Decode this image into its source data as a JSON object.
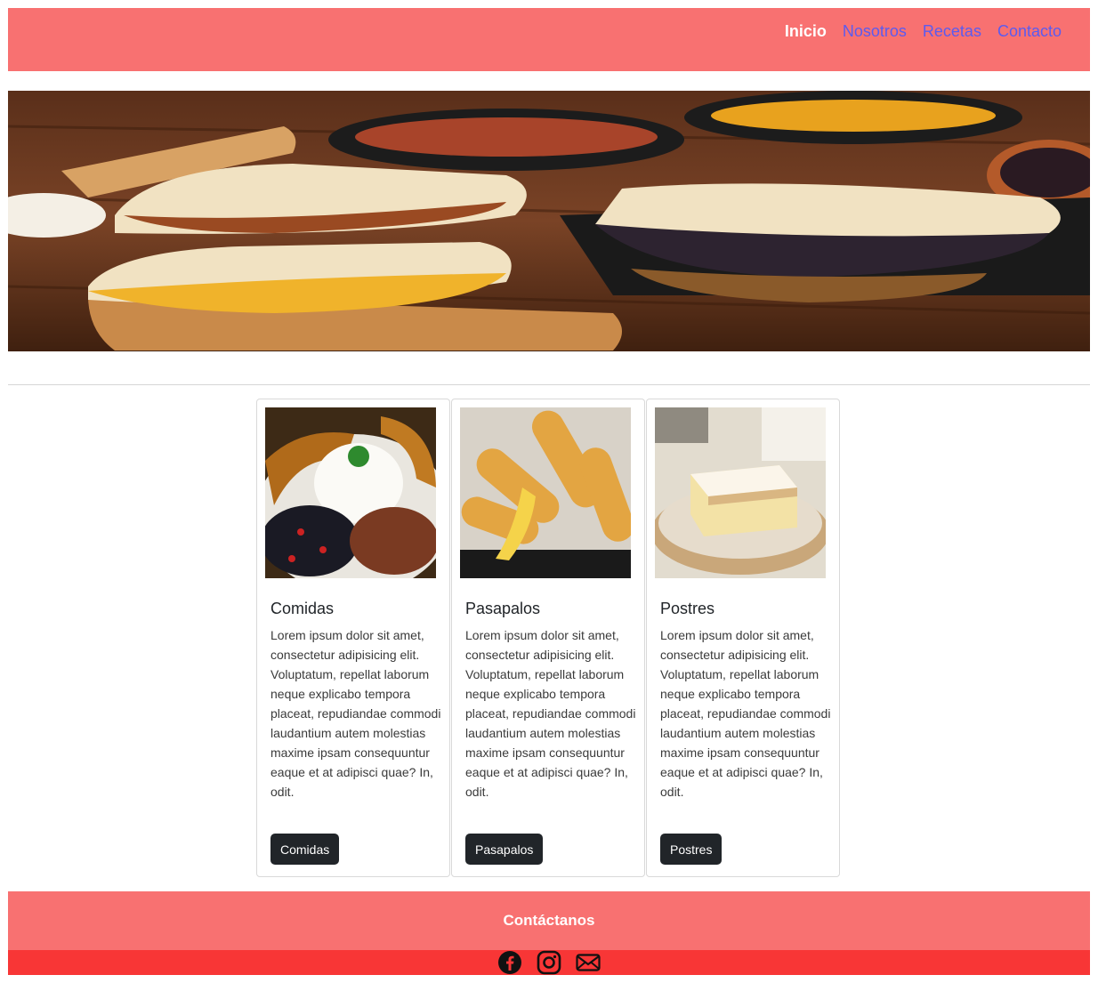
{
  "nav": {
    "links": [
      {
        "label": "Inicio",
        "active": true
      },
      {
        "label": "Nosotros"
      },
      {
        "label": "Recetas"
      },
      {
        "label": "Contacto"
      }
    ]
  },
  "hero": {
    "image": "venezuelan-arepas-photo"
  },
  "cards": [
    {
      "image": "comidas-photo",
      "title": "Comidas",
      "text": "Lorem ipsum dolor sit amet, consectetur adipisicing elit. Voluptatum, repellat laborum neque explicabo tempora placeat, repudiandae commodi laudantium autem molestias maxime ipsam consequuntur eaque et at adipisci quae? In, odit.",
      "button": "Comidas"
    },
    {
      "image": "pasapalos-photo",
      "title": "Pasapalos",
      "text": "Lorem ipsum dolor sit amet, consectetur adipisicing elit. Voluptatum, repellat laborum neque explicabo tempora placeat, repudiandae commodi laudantium autem molestias maxime ipsam consequuntur eaque et at adipisci quae? In, odit.",
      "button": "Pasapalos"
    },
    {
      "image": "postres-photo",
      "title": "Postres",
      "text": "Lorem ipsum dolor sit amet, consectetur adipisicing elit. Voluptatum, repellat laborum neque explicabo tempora placeat, repudiandae commodi laudantium autem molestias maxime ipsam consequuntur eaque et at adipisci quae? In, odit.",
      "button": "Postres"
    }
  ],
  "footer": {
    "title": "Contáctanos"
  },
  "social": [
    {
      "icon": "facebook-icon"
    },
    {
      "icon": "instagram-icon"
    },
    {
      "icon": "mail-icon"
    }
  ],
  "colors": {
    "navbar": "#f87171",
    "nav_link": "#5b5bf0",
    "nav_active": "#ffffff",
    "footer": "#f87171",
    "social_bar": "#f83636",
    "button": "#212529"
  }
}
